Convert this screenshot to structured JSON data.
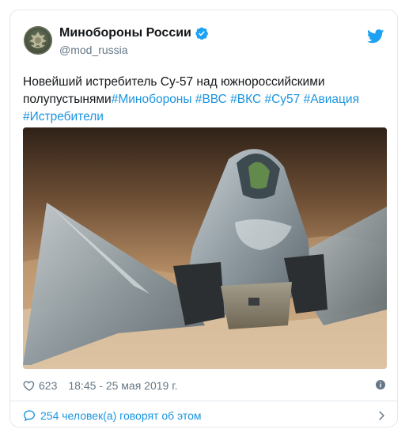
{
  "account": {
    "display_name": "Минобороны России",
    "handle": "@mod_russia",
    "verified": true
  },
  "tweet": {
    "text": "Новейший истребитель Су-57 над южнороссийскими полупустынями",
    "hashtags": [
      "#Минобороны",
      "#ВВС",
      "#ВКС",
      "#Су57",
      "#Авиация",
      "#Истребители"
    ]
  },
  "meta": {
    "likes": "623",
    "timestamp": "18:45 - 25 мая 2019 г."
  },
  "replies": {
    "label": "254 человек(а) говорят об этом"
  },
  "icons": {
    "avatar": "emblem-avatar",
    "verified": "verified-badge-icon",
    "logo": "twitter-bird-icon",
    "like": "heart-icon",
    "info": "info-icon",
    "reply": "speech-bubble-icon",
    "chevron": "chevron-right-icon"
  },
  "colors": {
    "link": "#1b95e0",
    "text": "#14171a",
    "muted": "#657786",
    "border": "#e1e8ed"
  }
}
